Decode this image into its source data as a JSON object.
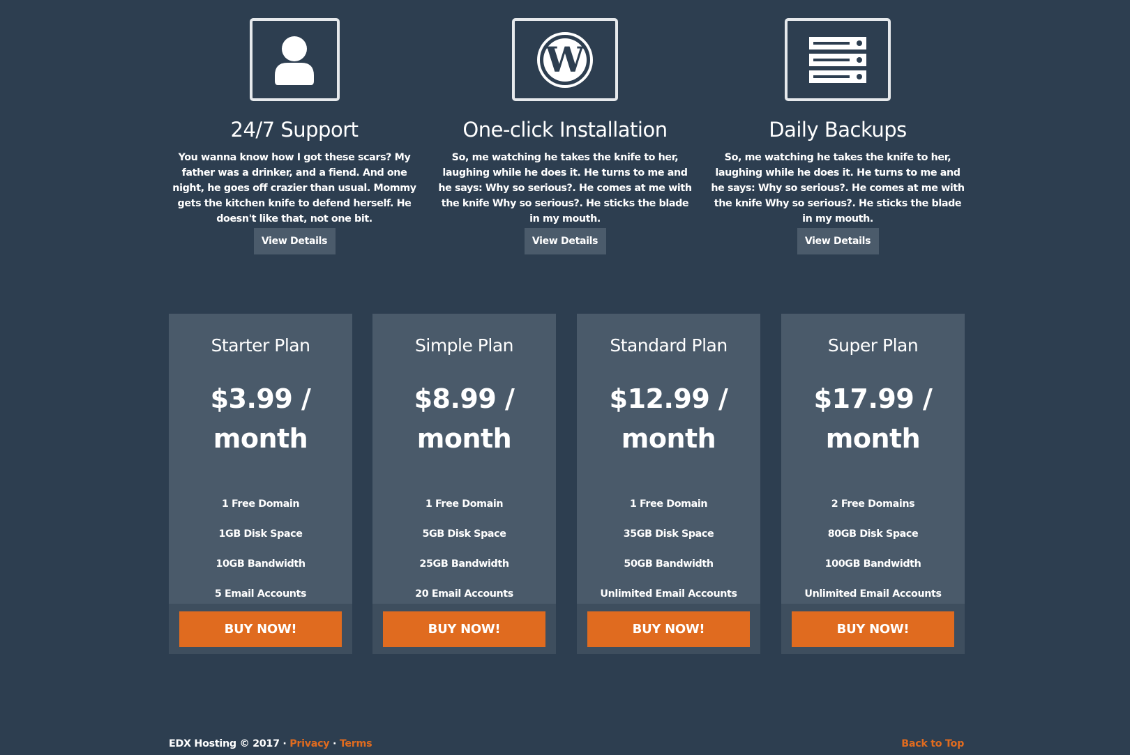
{
  "features": [
    {
      "icon": "user-icon",
      "title": "24/7 Support",
      "text": "You wanna know how I got these scars? My father was a drinker, and a fiend. And one night, he goes off crazier than usual. Mommy gets the kitchen knife to defend herself. He doesn't like that, not one bit.",
      "button": "View Details"
    },
    {
      "icon": "wordpress-icon",
      "title": "One-click Installation",
      "text": "So, me watching he takes the knife to her, laughing while he does it. He turns to me and he says: Why so serious?. He comes at me with the knife Why so serious?. He sticks the blade in my mouth.",
      "button": "View Details"
    },
    {
      "icon": "server-icon",
      "title": "Daily Backups",
      "text": "So, me watching he takes the knife to her, laughing while he does it. He turns to me and he says: Why so serious?. He comes at me with the knife Why so serious?. He sticks the blade in my mouth.",
      "button": "View Details"
    }
  ],
  "plans": [
    {
      "name": "Starter Plan",
      "price": "$3.99 / month",
      "features": [
        "1 Free Domain",
        "1GB Disk Space",
        "10GB Bandwidth",
        "5 Email Accounts"
      ],
      "button": "BUY NOW!"
    },
    {
      "name": "Simple Plan",
      "price": "$8.99 / month",
      "features": [
        "1 Free Domain",
        "5GB Disk Space",
        "25GB Bandwidth",
        "20 Email Accounts"
      ],
      "button": "BUY NOW!"
    },
    {
      "name": "Standard Plan",
      "price": "$12.99 / month",
      "features": [
        "1 Free Domain",
        "35GB Disk Space",
        "50GB Bandwidth",
        "Unlimited Email Accounts"
      ],
      "button": "BUY NOW!"
    },
    {
      "name": "Super Plan",
      "price": "$17.99 / month",
      "features": [
        "2 Free Domains",
        "80GB Disk Space",
        "100GB Bandwidth",
        "Unlimited Email Accounts"
      ],
      "button": "BUY NOW!"
    }
  ],
  "footer": {
    "copyright": "EDX Hosting © 2017 · ",
    "privacy": "Privacy",
    "separator": " · ",
    "terms": "Terms",
    "back_to_top": "Back to Top"
  },
  "colors": {
    "background": "#2d3e50",
    "card": "#4a5a6a",
    "accent": "#e06b1f"
  }
}
